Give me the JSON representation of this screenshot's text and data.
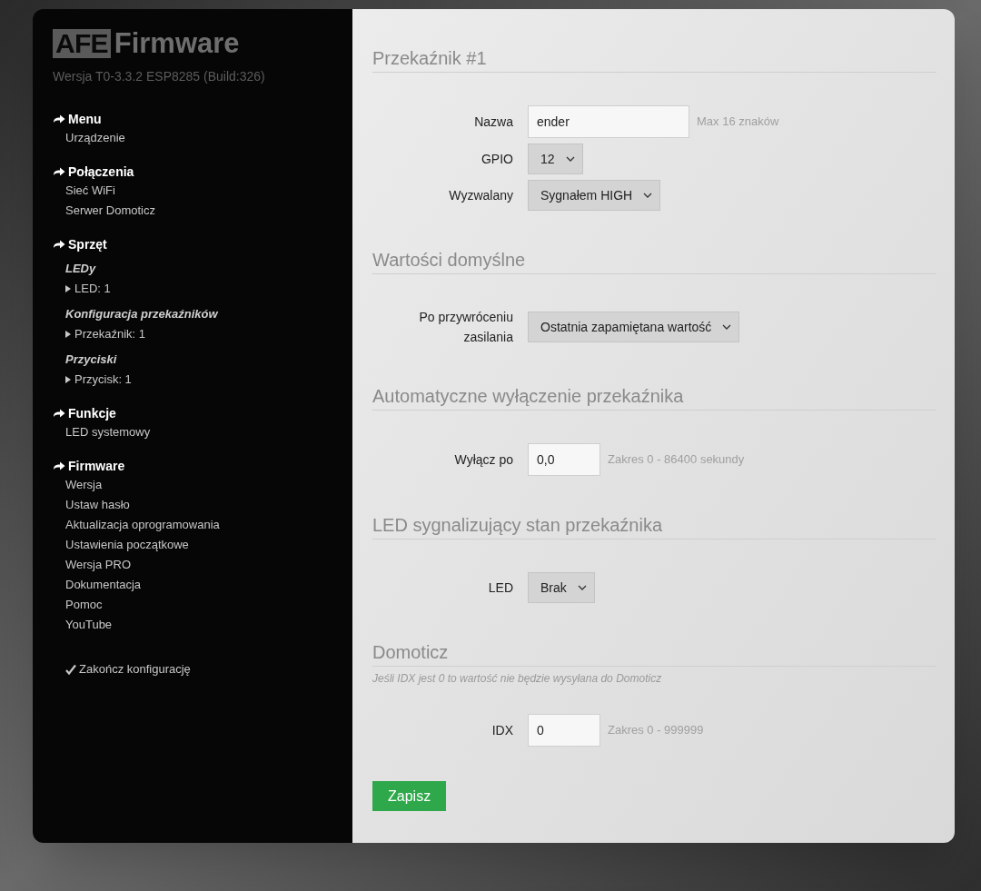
{
  "logo": {
    "mark": "AFE",
    "text": "Firmware"
  },
  "version": "Wersja T0-3.3.2 ESP8285 (Build:326)",
  "sidebar": {
    "sections": [
      {
        "title": "Menu",
        "items": [
          {
            "kind": "link",
            "label": "Urządzenie"
          }
        ]
      },
      {
        "title": "Połączenia",
        "items": [
          {
            "kind": "link",
            "label": "Sieć WiFi"
          },
          {
            "kind": "link",
            "label": "Serwer Domoticz"
          }
        ]
      },
      {
        "title": "Sprzęt",
        "items": [
          {
            "kind": "subheading",
            "label": "LEDy"
          },
          {
            "kind": "subitem",
            "label": "LED: 1"
          },
          {
            "kind": "subheading",
            "label": "Konfiguracja przekaźników"
          },
          {
            "kind": "subitem",
            "label": "Przekaźnik: 1"
          },
          {
            "kind": "subheading",
            "label": "Przyciski"
          },
          {
            "kind": "subitem",
            "label": "Przycisk: 1"
          }
        ]
      },
      {
        "title": "Funkcje",
        "items": [
          {
            "kind": "link",
            "label": "LED systemowy"
          }
        ]
      },
      {
        "title": "Firmware",
        "items": [
          {
            "kind": "link",
            "label": "Wersja"
          },
          {
            "kind": "link",
            "label": "Ustaw hasło"
          },
          {
            "kind": "link",
            "label": "Aktualizacja oprogramowania"
          },
          {
            "kind": "link",
            "label": "Ustawienia początkowe"
          },
          {
            "kind": "link",
            "label": "Wersja PRO"
          },
          {
            "kind": "link",
            "label": "Dokumentacja"
          },
          {
            "kind": "link",
            "label": "Pomoc"
          },
          {
            "kind": "link",
            "label": "YouTube"
          }
        ]
      }
    ],
    "finish": "Zakończ konfigurację"
  },
  "form": {
    "sections": [
      {
        "title": "Przekaźnik #1",
        "fields": [
          {
            "kind": "text",
            "label": "Nazwa",
            "value": "ender",
            "hint": "Max 16 znaków"
          },
          {
            "kind": "select",
            "label": "GPIO",
            "value": "12"
          },
          {
            "kind": "select",
            "label": "Wyzwalany",
            "value": "Sygnałem HIGH"
          }
        ]
      },
      {
        "title": "Wartości domyślne",
        "fields": [
          {
            "kind": "select",
            "label": "Po przywróceniu zasilania",
            "value": "Ostatnia zapamiętana wartość"
          }
        ]
      },
      {
        "title": "Automatyczne wyłączenie przekaźnika",
        "fields": [
          {
            "kind": "number",
            "label": "Wyłącz po",
            "value": "0,0",
            "hint": "Zakres 0 - 86400 sekundy"
          }
        ]
      },
      {
        "title": "LED sygnalizujący stan przekaźnika",
        "fields": [
          {
            "kind": "select",
            "label": "LED",
            "value": "Brak"
          }
        ]
      },
      {
        "title": "Domoticz",
        "note": "Jeśli IDX jest 0 to wartość nie będzie wysyłana do Domoticz",
        "fields": [
          {
            "kind": "number",
            "label": "IDX",
            "value": "0",
            "hint": "Zakres 0 - 999999"
          }
        ]
      }
    ],
    "save_button": "Zapisz"
  }
}
